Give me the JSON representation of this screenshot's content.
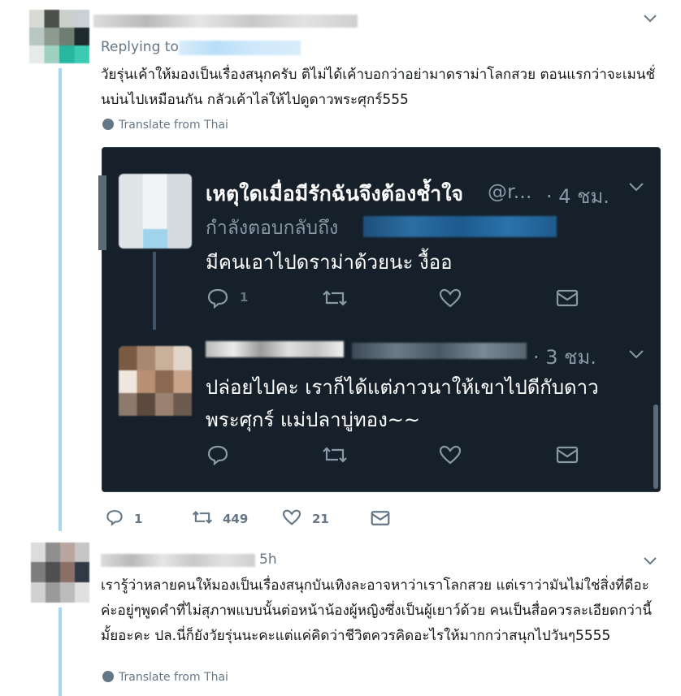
{
  "tweet1": {
    "replying_to_label": "Replying to",
    "body": "วัยรุ่นเค้าให้มองเป็นเรื่องสนุกครับ ติไม่ได้เค้าบอกว่าอย่ามาดราม่าโลกสวย ตอนแรกว่าจะเมนชั่นบ่นไปเหมือนกัน กลัวเค้าไล่ให้ไปดูดาวพระศุกร์555",
    "translate_label": "Translate from Thai",
    "reply_count": "1",
    "retweet_count": "449",
    "like_count": "21"
  },
  "embedded": {
    "tweet_a": {
      "display_name": "เหตุใดเมื่อมีรักฉันจึงต้องช้ำใจ",
      "handle": "@r...",
      "time": "· 4 ชม.",
      "replying_label": "กำลังตอบกลับถึง",
      "body": "มีคนเอาไปดราม่าด้วยนะ งื้ออ",
      "reply_count": "1"
    },
    "tweet_b": {
      "time": "· 3 ชม.",
      "body_line1": "ปล่อยไปคะ เราก็ได้แต่ภาวนาให้เขาไปดีกับดาว",
      "body_line2": "พระศุกร์ แม่ปลาบู่ทอง~~"
    }
  },
  "tweet2": {
    "time": "5h",
    "body": "เรารู้ว่าหลายคนให้มองเป็นเรื่องสนุกบันเทิงละอาจหาว่าเราโลกสวย แต่เราว่ามันไม่ใช่สิ่งที่ดีอะค่ะอยู่ๆพูดคำที่ไม่สุภาพแบบนั้นต่อหน้าน้องผู้หญิงซึ่งเป็นผู้เยาว์ด้วย คนเป็นสื่อควรละเอียดกว่านี้มั้ยอะคะ ปล.นี่ก็ยังวัยรุ่นนะคะแต่แค่คิดว่าชีวิตควรคิดอะไรให้มากกว่าสนุกไปวันๆ5555",
    "translate_label": "Translate from Thai"
  },
  "icons": {
    "chevron": "chevron-down-icon",
    "reply": "reply-icon",
    "retweet": "retweet-icon",
    "like": "heart-icon",
    "message": "envelope-icon",
    "globe": "globe-icon"
  }
}
